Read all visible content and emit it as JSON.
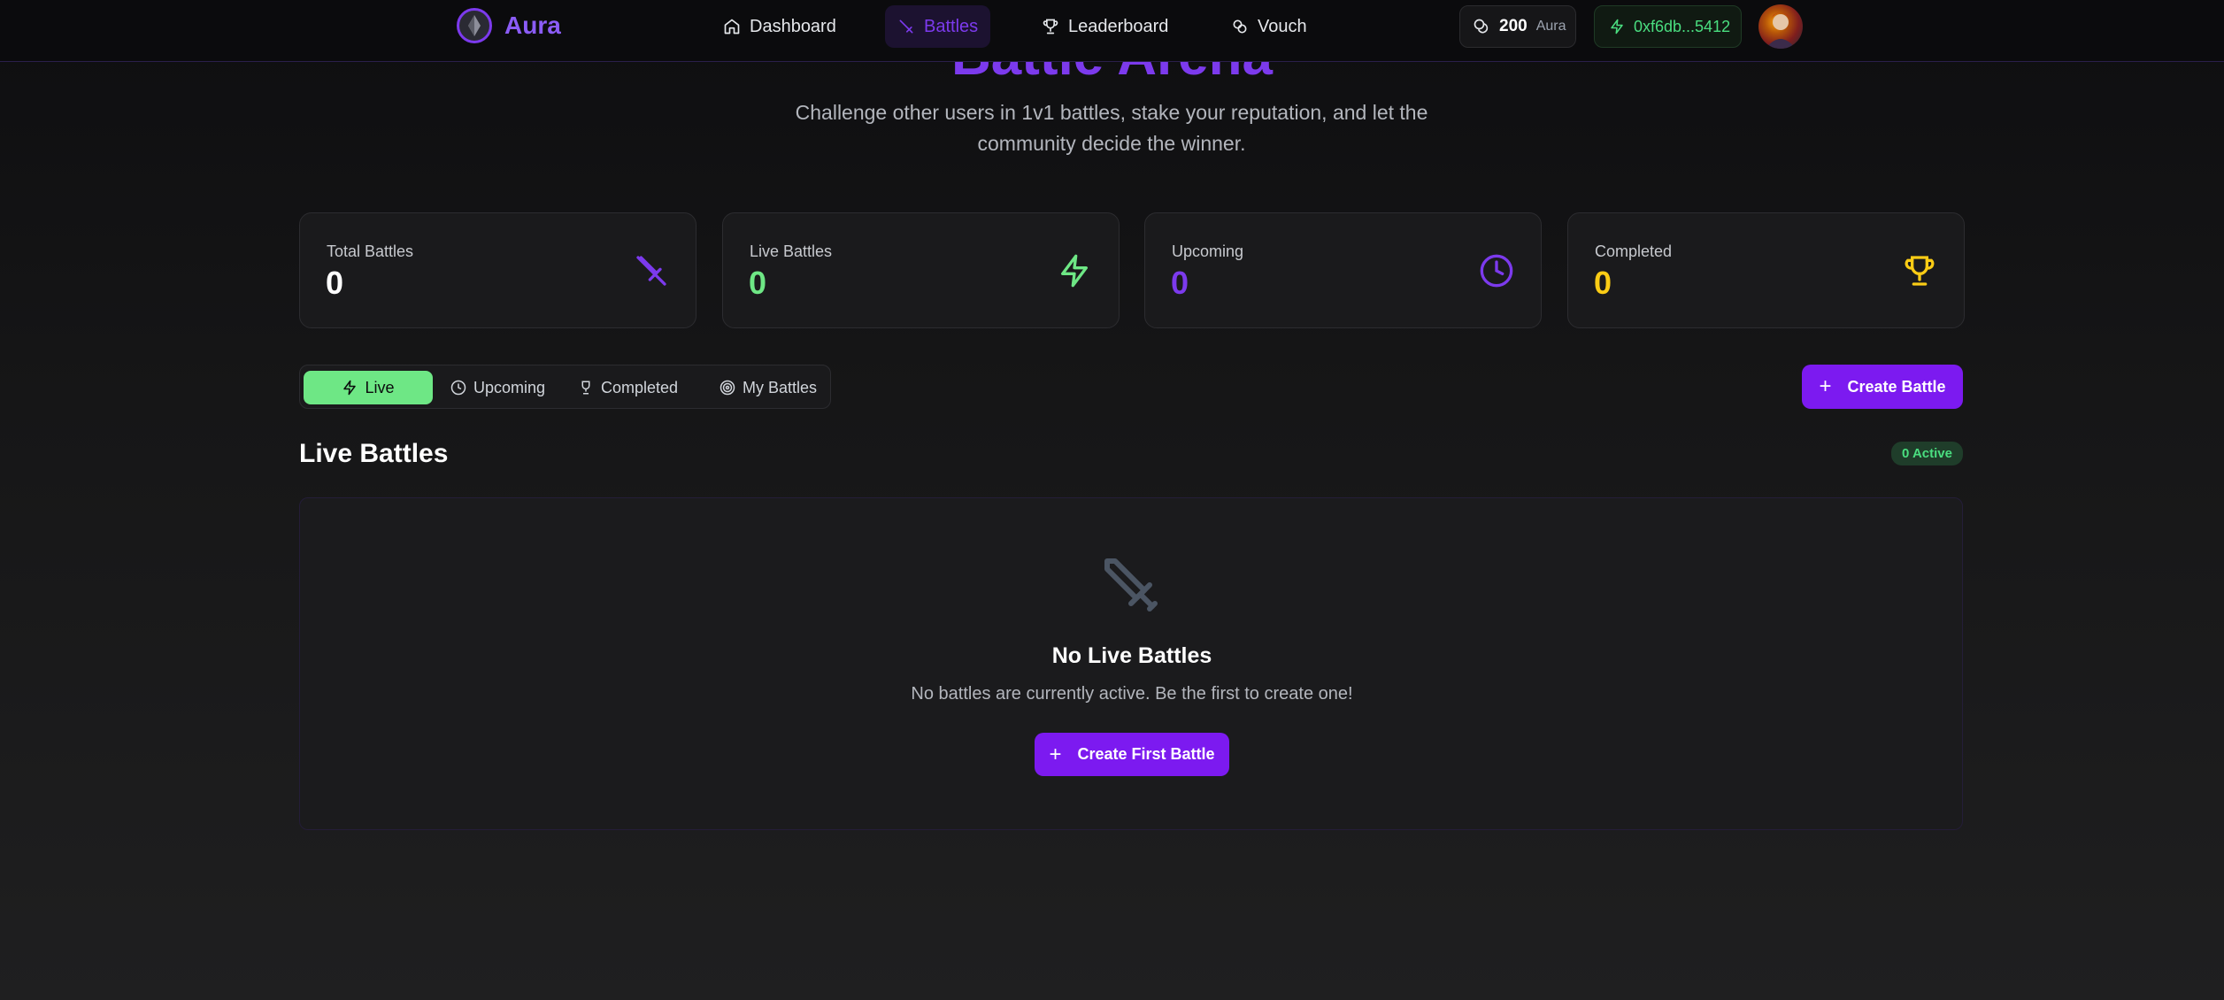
{
  "brand": {
    "name": "Aura"
  },
  "nav": {
    "items": [
      {
        "label": "Dashboard",
        "icon": "home-icon"
      },
      {
        "label": "Battles",
        "icon": "sword-icon",
        "active": true
      },
      {
        "label": "Leaderboard",
        "icon": "trophy-icon"
      },
      {
        "label": "Vouch",
        "icon": "link-icon"
      }
    ]
  },
  "header": {
    "aura_balance": "200",
    "aura_unit": "Aura",
    "wallet_address": "0xf6db...5412"
  },
  "hero": {
    "title": "Battle Arena",
    "subtitle": "Challenge other users in 1v1 battles, stake your reputation, and let the community decide the winner."
  },
  "stats": [
    {
      "label": "Total Battles",
      "value": "0",
      "color": "#ffffff",
      "icon": "sword-icon",
      "icon_color": "#7c3aed"
    },
    {
      "label": "Live Battles",
      "value": "0",
      "color": "#6ee785",
      "icon": "lightning-icon",
      "icon_color": "#6ee785"
    },
    {
      "label": "Upcoming",
      "value": "0",
      "color": "#7c3aed",
      "icon": "clock-icon",
      "icon_color": "#7c3aed"
    },
    {
      "label": "Completed",
      "value": "0",
      "color": "#facc15",
      "icon": "trophy-icon",
      "icon_color": "#facc15"
    }
  ],
  "tabs": [
    {
      "label": "Live",
      "icon": "lightning-icon",
      "active": true
    },
    {
      "label": "Upcoming",
      "icon": "clock-icon"
    },
    {
      "label": "Completed",
      "icon": "trophy-icon"
    },
    {
      "label": "My Battles",
      "icon": "target-icon"
    }
  ],
  "actions": {
    "create_battle": "Create Battle",
    "plus": "+"
  },
  "section": {
    "title": "Live Battles",
    "badge": "0 Active"
  },
  "empty_state": {
    "icon": "sword-icon",
    "title": "No Live Battles",
    "description": "No battles are currently active. Be the first to create one!",
    "button": "Create First Battle"
  },
  "colors": {
    "accent": "#7c1af0",
    "live_green": "#6ee785"
  }
}
